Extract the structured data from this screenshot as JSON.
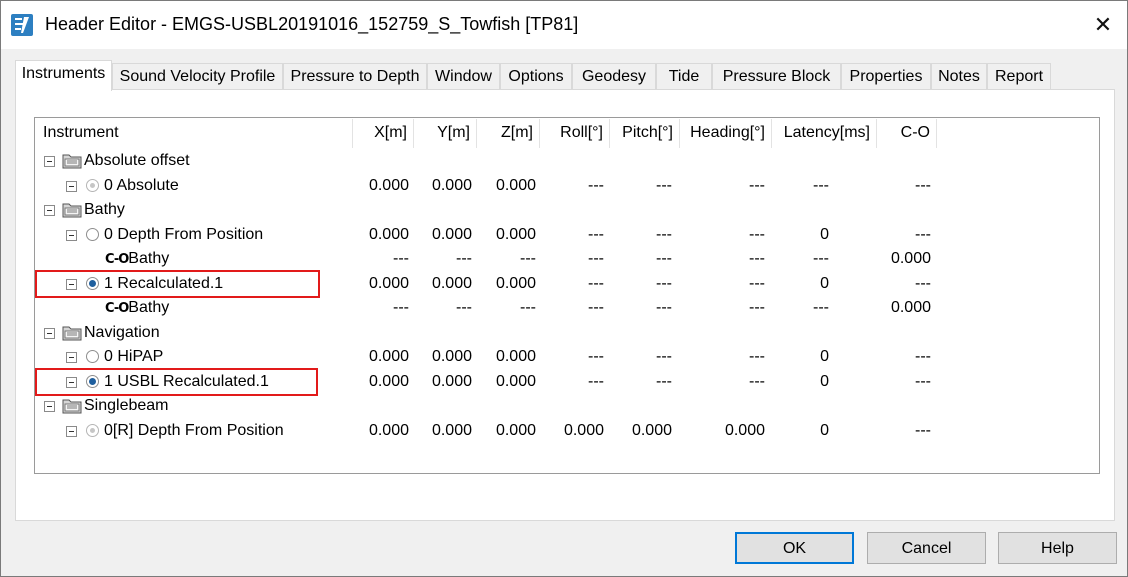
{
  "window": {
    "title": "Header Editor - EMGS-USBL20191016_152759_S_Towfish [TP81]",
    "close_glyph": "✕"
  },
  "tabs": [
    {
      "label": "Instruments",
      "active": true
    },
    {
      "label": "Sound Velocity Profile"
    },
    {
      "label": "Pressure to Depth"
    },
    {
      "label": "Window"
    },
    {
      "label": "Options"
    },
    {
      "label": "Geodesy"
    },
    {
      "label": "Tide"
    },
    {
      "label": "Pressure Block"
    },
    {
      "label": "Properties"
    },
    {
      "label": "Notes"
    },
    {
      "label": "Report"
    }
  ],
  "columns": [
    "Instrument",
    "X[m]",
    "Y[m]",
    "Z[m]",
    "Roll[°]",
    "Pitch[°]",
    "Heading[°]",
    "Latency[ms]",
    "C-O"
  ],
  "rows": [
    {
      "type": "group",
      "label": "Absolute offset"
    },
    {
      "type": "instrument",
      "label": "0 Absolute",
      "radio": "dim",
      "values": [
        "0.000",
        "0.000",
        "0.000",
        "---",
        "---",
        "---",
        "---",
        "---"
      ]
    },
    {
      "type": "group",
      "label": "Bathy"
    },
    {
      "type": "instrument",
      "label": "0 Depth From Position",
      "radio": "off",
      "values": [
        "0.000",
        "0.000",
        "0.000",
        "---",
        "---",
        "---",
        "0",
        "---"
      ]
    },
    {
      "type": "co",
      "prefix": "C-O",
      "label": "Bathy",
      "values": [
        "---",
        "---",
        "---",
        "---",
        "---",
        "---",
        "---",
        "0.000"
      ]
    },
    {
      "type": "instrument",
      "label": "1 Recalculated.1",
      "radio": "on",
      "highlighted": true,
      "values": [
        "0.000",
        "0.000",
        "0.000",
        "---",
        "---",
        "---",
        "0",
        "---"
      ]
    },
    {
      "type": "co",
      "prefix": "C-O",
      "label": "Bathy",
      "values": [
        "---",
        "---",
        "---",
        "---",
        "---",
        "---",
        "---",
        "0.000"
      ]
    },
    {
      "type": "group",
      "label": "Navigation"
    },
    {
      "type": "instrument",
      "label": "0 HiPAP",
      "radio": "off",
      "values": [
        "0.000",
        "0.000",
        "0.000",
        "---",
        "---",
        "---",
        "0",
        "---"
      ]
    },
    {
      "type": "instrument",
      "label": "1 USBL Recalculated.1",
      "radio": "on",
      "highlighted": true,
      "values": [
        "0.000",
        "0.000",
        "0.000",
        "---",
        "---",
        "---",
        "0",
        "---"
      ]
    },
    {
      "type": "group",
      "label": "Singlebeam"
    },
    {
      "type": "instrument",
      "label": "0[R] Depth From Position",
      "radio": "dim",
      "values": [
        "0.000",
        "0.000",
        "0.000",
        "0.000",
        "0.000",
        "0.000",
        "0",
        "---"
      ]
    }
  ],
  "buttons": {
    "ok": "OK",
    "cancel": "Cancel",
    "help": "Help"
  },
  "colors": {
    "highlight": "#e21a1a",
    "accent": "#0078d7"
  }
}
